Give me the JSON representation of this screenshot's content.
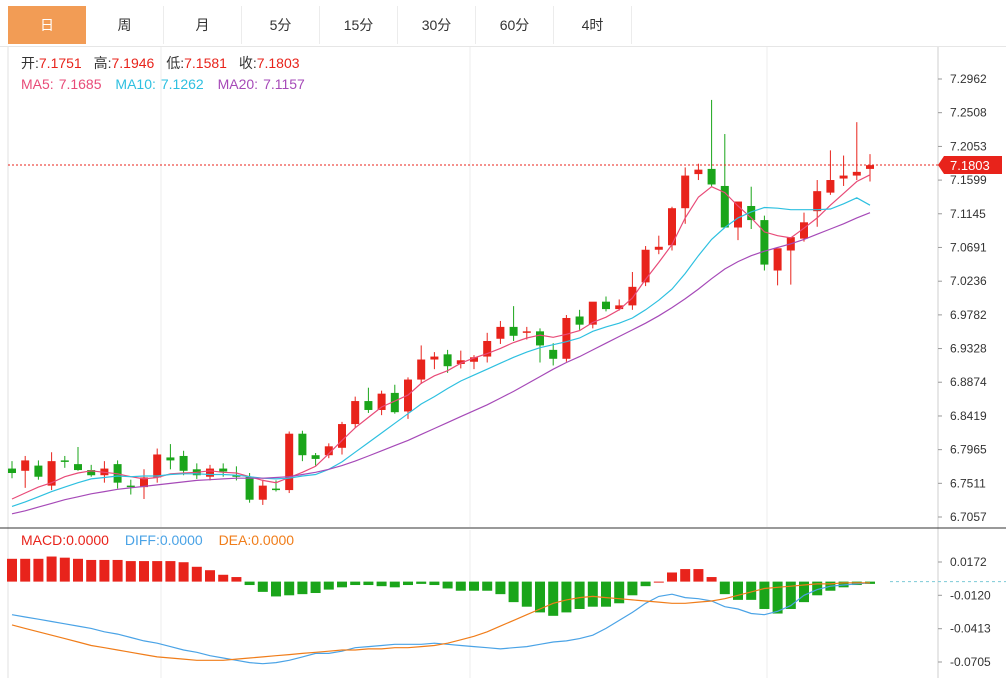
{
  "tabs": [
    "日",
    "周",
    "月",
    "5分",
    "15分",
    "30分",
    "60分",
    "4时"
  ],
  "active_tab": 0,
  "ohlc_legend": {
    "open_label": "开:",
    "open": "7.1751",
    "high_label": "高:",
    "high": "7.1946",
    "low_label": "低:",
    "low": "7.1581",
    "close_label": "收:",
    "close": "7.1803"
  },
  "ma_legend": {
    "ma5_label": "MA5:",
    "ma5": "7.1685",
    "ma10_label": "MA10:",
    "ma10": "7.1262",
    "ma20_label": "MA20:",
    "ma20": "7.1157"
  },
  "macd_legend": {
    "macd_label": "MACD:",
    "macd": "0.0000",
    "diff_label": "DIFF:",
    "diff": "0.0000",
    "dea_label": "DEA:",
    "dea": "0.0000"
  },
  "colors": {
    "up": "#e8231b",
    "down": "#1aa51a",
    "ma5": "#e84b78",
    "ma10": "#2ec0e0",
    "ma20": "#a64ab8",
    "diff": "#4aa3e6",
    "dea": "#f07d1a",
    "tab_active": "#f29c55"
  },
  "chart_data": [
    {
      "type": "candlestick",
      "title": "",
      "y_ticks": [
        "7.2962",
        "7.2508",
        "7.2053",
        "7.1599",
        "7.1145",
        "7.0691",
        "7.0236",
        "6.9782",
        "6.9328",
        "6.8874",
        "6.8419",
        "6.7965",
        "6.7511",
        "6.7057"
      ],
      "ylim": [
        6.7057,
        7.2962
      ],
      "current_price": "7.1803",
      "candles": [
        [
          6.771,
          6.781,
          6.758,
          6.765
        ],
        [
          6.768,
          6.788,
          6.745,
          6.782
        ],
        [
          6.775,
          6.782,
          6.756,
          6.76
        ],
        [
          6.748,
          6.793,
          6.742,
          6.781
        ],
        [
          6.782,
          6.788,
          6.772,
          6.78
        ],
        [
          6.777,
          6.8,
          6.768,
          6.769
        ],
        [
          6.769,
          6.776,
          6.76,
          6.762
        ],
        [
          6.762,
          6.781,
          6.752,
          6.771
        ],
        [
          6.777,
          6.782,
          6.744,
          6.752
        ],
        [
          6.748,
          6.756,
          6.736,
          6.746
        ],
        [
          6.746,
          6.77,
          6.73,
          6.759
        ],
        [
          6.759,
          6.798,
          6.752,
          6.79
        ],
        [
          6.786,
          6.804,
          6.77,
          6.782
        ],
        [
          6.788,
          6.795,
          6.762,
          6.768
        ],
        [
          6.77,
          6.778,
          6.757,
          6.762
        ],
        [
          6.76,
          6.776,
          6.755,
          6.771
        ],
        [
          6.771,
          6.778,
          6.76,
          6.767
        ],
        [
          6.762,
          6.774,
          6.755,
          6.76
        ],
        [
          6.76,
          6.765,
          6.725,
          6.729
        ],
        [
          6.729,
          6.756,
          6.722,
          6.748
        ],
        [
          6.744,
          6.755,
          6.74,
          6.742
        ],
        [
          6.742,
          6.821,
          6.738,
          6.818
        ],
        [
          6.818,
          6.822,
          6.781,
          6.789
        ],
        [
          6.789,
          6.792,
          6.775,
          6.784
        ],
        [
          6.789,
          6.805,
          6.785,
          6.801
        ],
        [
          6.799,
          6.834,
          6.79,
          6.831
        ],
        [
          6.831,
          6.868,
          6.826,
          6.862
        ],
        [
          6.862,
          6.88,
          6.846,
          6.85
        ],
        [
          6.85,
          6.876,
          6.843,
          6.872
        ],
        [
          6.873,
          6.884,
          6.845,
          6.847
        ],
        [
          6.848,
          6.894,
          6.838,
          6.891
        ],
        [
          6.891,
          6.937,
          6.885,
          6.918
        ],
        [
          6.918,
          6.928,
          6.905,
          6.922
        ],
        [
          6.925,
          6.931,
          6.9,
          6.909
        ],
        [
          6.912,
          6.93,
          6.906,
          6.917
        ],
        [
          6.915,
          6.924,
          6.905,
          6.921
        ],
        [
          6.922,
          6.954,
          6.914,
          6.943
        ],
        [
          6.946,
          6.97,
          6.939,
          6.962
        ],
        [
          6.962,
          6.99,
          6.943,
          6.95
        ],
        [
          6.954,
          6.962,
          6.945,
          6.956
        ],
        [
          6.956,
          6.96,
          6.914,
          6.937
        ],
        [
          6.931,
          6.94,
          6.91,
          6.919
        ],
        [
          6.919,
          6.978,
          6.915,
          6.974
        ],
        [
          6.976,
          6.985,
          6.958,
          6.965
        ],
        [
          6.965,
          6.994,
          6.96,
          6.996
        ],
        [
          6.996,
          7.003,
          6.983,
          6.986
        ],
        [
          6.986,
          6.999,
          6.984,
          6.991
        ],
        [
          6.991,
          7.036,
          6.985,
          7.016
        ],
        [
          7.022,
          7.071,
          7.017,
          7.066
        ],
        [
          7.066,
          7.085,
          7.06,
          7.07
        ],
        [
          7.072,
          7.124,
          7.065,
          7.122
        ],
        [
          7.122,
          7.177,
          7.101,
          7.166
        ],
        [
          7.168,
          7.182,
          7.16,
          7.174
        ],
        [
          7.175,
          7.268,
          7.151,
          7.154
        ],
        [
          7.152,
          7.222,
          7.101,
          7.096
        ],
        [
          7.096,
          7.118,
          7.079,
          7.131
        ],
        [
          7.125,
          7.151,
          7.094,
          7.106
        ],
        [
          7.106,
          7.112,
          7.038,
          7.046
        ],
        [
          7.038,
          7.066,
          7.018,
          7.068
        ],
        [
          7.065,
          7.082,
          7.019,
          7.083
        ],
        [
          7.081,
          7.116,
          7.077,
          7.103
        ],
        [
          7.118,
          7.16,
          7.097,
          7.145
        ],
        [
          7.143,
          7.2,
          7.14,
          7.16
        ],
        [
          7.162,
          7.193,
          7.152,
          7.166
        ],
        [
          7.166,
          7.238,
          7.16,
          7.171
        ],
        [
          7.175,
          7.195,
          7.158,
          7.18
        ]
      ],
      "ma5": [
        6.73,
        6.738,
        6.746,
        6.752,
        6.76,
        6.765,
        6.768,
        6.766,
        6.764,
        6.76,
        6.757,
        6.759,
        6.764,
        6.765,
        6.766,
        6.768,
        6.766,
        6.765,
        6.76,
        6.755,
        6.752,
        6.759,
        6.766,
        6.774,
        6.791,
        6.809,
        6.826,
        6.84,
        6.854,
        6.862,
        6.87,
        6.886,
        6.896,
        6.903,
        6.913,
        6.92,
        6.926,
        6.933,
        6.941,
        6.947,
        6.951,
        6.948,
        6.952,
        6.957,
        6.968,
        6.975,
        6.985,
        7.001,
        7.026,
        7.049,
        7.073,
        7.109,
        7.137,
        7.151,
        7.143,
        7.125,
        7.109,
        7.09,
        7.085,
        7.082,
        7.095,
        7.109,
        7.126,
        7.142,
        7.158,
        7.167
      ],
      "ma10": [
        6.72,
        6.726,
        6.733,
        6.74,
        6.746,
        6.752,
        6.757,
        6.759,
        6.761,
        6.76,
        6.761,
        6.761,
        6.763,
        6.764,
        6.764,
        6.763,
        6.763,
        6.762,
        6.76,
        6.758,
        6.757,
        6.758,
        6.761,
        6.763,
        6.77,
        6.78,
        6.793,
        6.806,
        6.819,
        6.832,
        6.845,
        6.858,
        6.868,
        6.879,
        6.889,
        6.897,
        6.905,
        6.913,
        6.921,
        6.928,
        6.934,
        6.938,
        6.942,
        6.947,
        6.956,
        6.962,
        6.967,
        6.974,
        6.985,
        6.998,
        7.013,
        7.034,
        7.058,
        7.08,
        7.096,
        7.109,
        7.117,
        7.123,
        7.122,
        7.12,
        7.12,
        7.12,
        7.121,
        7.128,
        7.136,
        7.126
      ],
      "ma20": [
        6.71,
        6.714,
        6.719,
        6.724,
        6.729,
        6.733,
        6.737,
        6.74,
        6.743,
        6.745,
        6.747,
        6.749,
        6.751,
        6.753,
        6.755,
        6.756,
        6.757,
        6.758,
        6.758,
        6.758,
        6.759,
        6.76,
        6.763,
        6.766,
        6.77,
        6.775,
        6.781,
        6.788,
        6.795,
        6.802,
        6.809,
        6.817,
        6.825,
        6.833,
        6.841,
        6.849,
        6.857,
        6.866,
        6.875,
        6.885,
        6.895,
        6.905,
        6.914,
        6.922,
        6.931,
        6.94,
        6.949,
        6.958,
        6.967,
        6.977,
        6.988,
        7.0,
        7.013,
        7.027,
        7.04,
        7.05,
        7.058,
        7.064,
        7.069,
        7.074,
        7.08,
        7.087,
        7.094,
        7.101,
        7.109,
        7.116
      ]
    },
    {
      "type": "bar",
      "title": "",
      "y_ticks": [
        "0.0172",
        "-0.0120",
        "-0.0413",
        "-0.0705"
      ],
      "ylim": [
        -0.0705,
        0.0172
      ],
      "macd": [
        0.02,
        0.02,
        0.02,
        0.022,
        0.021,
        0.02,
        0.019,
        0.019,
        0.019,
        0.018,
        0.018,
        0.018,
        0.018,
        0.017,
        0.013,
        0.01,
        0.006,
        0.004,
        -0.003,
        -0.009,
        -0.013,
        -0.012,
        -0.011,
        -0.01,
        -0.007,
        -0.005,
        -0.003,
        -0.003,
        -0.004,
        -0.005,
        -0.003,
        -0.002,
        -0.003,
        -0.006,
        -0.008,
        -0.008,
        -0.008,
        -0.011,
        -0.018,
        -0.022,
        -0.027,
        -0.03,
        -0.027,
        -0.024,
        -0.022,
        -0.022,
        -0.019,
        -0.012,
        -0.004,
        0.0,
        0.008,
        0.011,
        0.011,
        0.004,
        -0.011,
        -0.016,
        -0.016,
        -0.024,
        -0.028,
        -0.024,
        -0.018,
        -0.012,
        -0.008,
        -0.005,
        -0.003,
        -0.002
      ],
      "diff": [
        -0.029,
        -0.031,
        -0.033,
        -0.035,
        -0.037,
        -0.039,
        -0.041,
        -0.044,
        -0.046,
        -0.049,
        -0.052,
        -0.054,
        -0.057,
        -0.06,
        -0.062,
        -0.065,
        -0.067,
        -0.069,
        -0.071,
        -0.072,
        -0.071,
        -0.069,
        -0.066,
        -0.063,
        -0.063,
        -0.061,
        -0.058,
        -0.057,
        -0.056,
        -0.055,
        -0.055,
        -0.055,
        -0.054,
        -0.055,
        -0.056,
        -0.057,
        -0.058,
        -0.059,
        -0.058,
        -0.057,
        -0.055,
        -0.053,
        -0.052,
        -0.05,
        -0.047,
        -0.041,
        -0.034,
        -0.027,
        -0.019,
        -0.013,
        -0.011,
        -0.014,
        -0.015,
        -0.017,
        -0.022,
        -0.024,
        -0.028,
        -0.029,
        -0.026,
        -0.021,
        -0.012,
        -0.007,
        -0.004,
        -0.003,
        -0.002,
        -0.001
      ],
      "dea": [
        -0.038,
        -0.041,
        -0.044,
        -0.047,
        -0.05,
        -0.053,
        -0.056,
        -0.058,
        -0.06,
        -0.062,
        -0.064,
        -0.066,
        -0.067,
        -0.068,
        -0.069,
        -0.069,
        -0.069,
        -0.068,
        -0.067,
        -0.066,
        -0.065,
        -0.064,
        -0.063,
        -0.062,
        -0.061,
        -0.06,
        -0.06,
        -0.059,
        -0.059,
        -0.058,
        -0.058,
        -0.057,
        -0.056,
        -0.054,
        -0.051,
        -0.048,
        -0.044,
        -0.039,
        -0.034,
        -0.029,
        -0.024,
        -0.019,
        -0.016,
        -0.014,
        -0.013,
        -0.014,
        -0.015,
        -0.016,
        -0.017,
        -0.018,
        -0.019,
        -0.019,
        -0.018,
        -0.017,
        -0.015,
        -0.012,
        -0.009,
        -0.006,
        -0.005,
        -0.004,
        -0.003,
        -0.002,
        -0.002,
        -0.001,
        -0.001,
        -0.001
      ]
    }
  ]
}
